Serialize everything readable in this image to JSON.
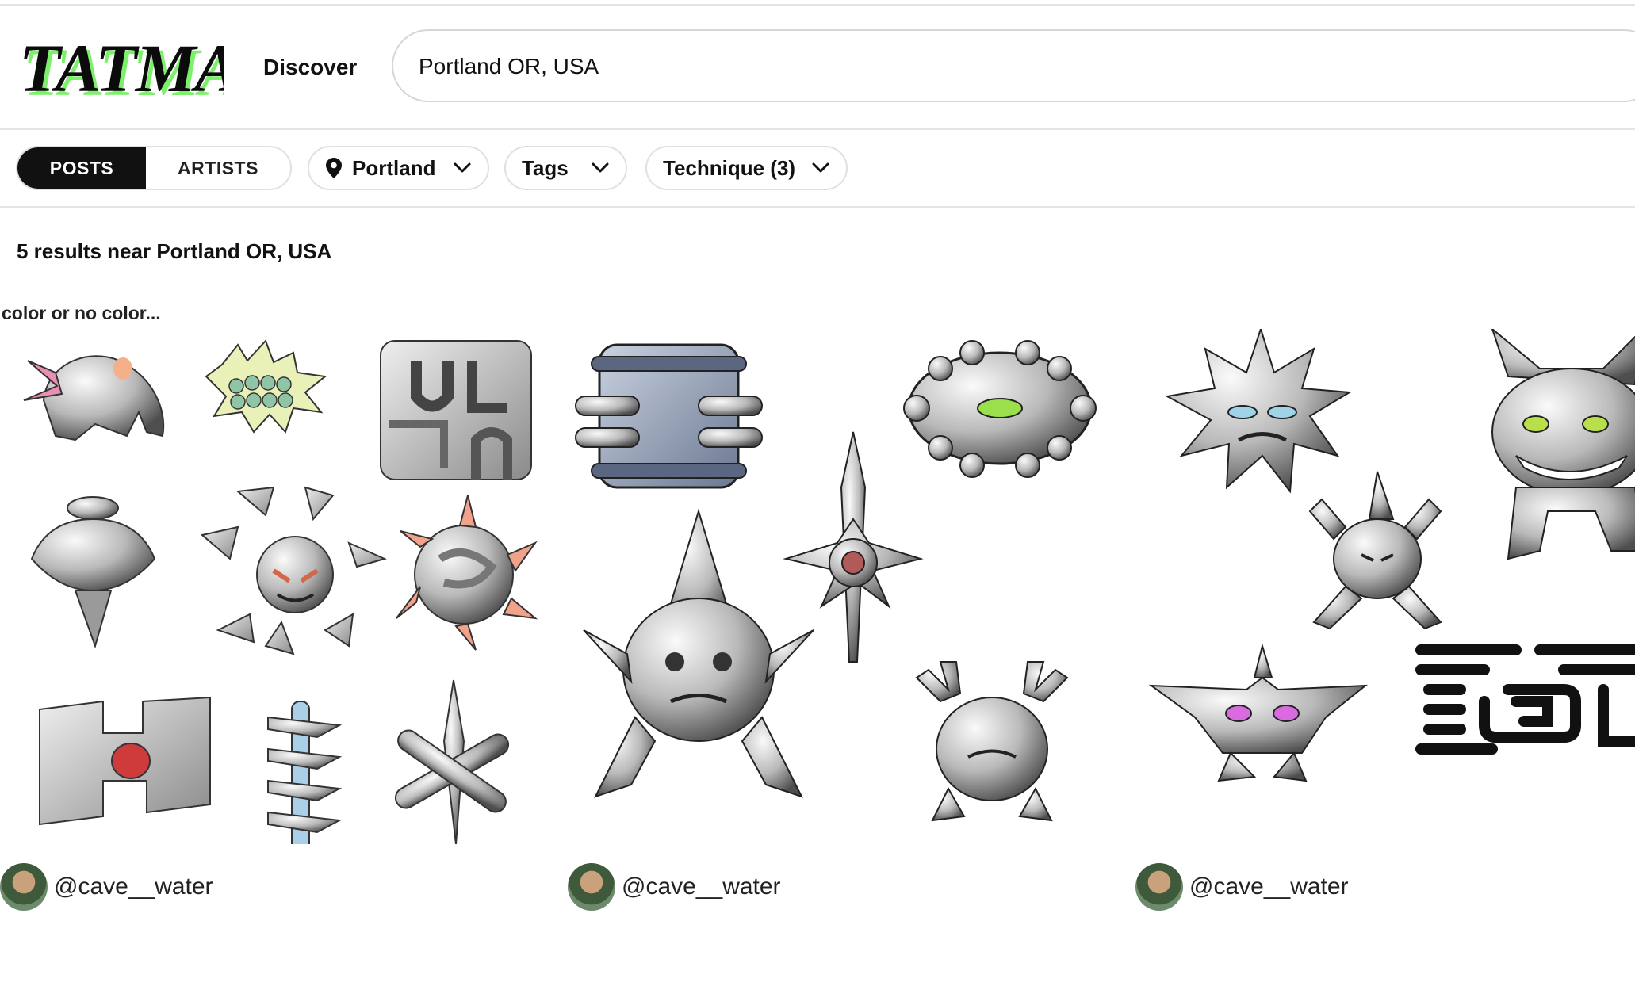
{
  "brand": {
    "logo_text": "TATMAP",
    "logo_accent": "#7cf06a"
  },
  "nav": {
    "discover_label": "Discover"
  },
  "search": {
    "value": "Portland OR, USA"
  },
  "filters": {
    "segments": {
      "posts_label": "POSTS",
      "artists_label": "ARTISTS",
      "active": "POSTS"
    },
    "location_label": "Portland",
    "tags_label": "Tags",
    "technique_label": "Technique (3)"
  },
  "results_text": "5 results near Portland OR, USA",
  "posts": [
    {
      "title": "color or no color...",
      "username": "@cave__water"
    },
    {
      "title": "",
      "username": "@cave__water"
    },
    {
      "title": "",
      "username": "@cave__water"
    }
  ],
  "colors": {
    "text": "#111111",
    "active_segment_bg": "#111111",
    "border": "#e0e0e0"
  }
}
